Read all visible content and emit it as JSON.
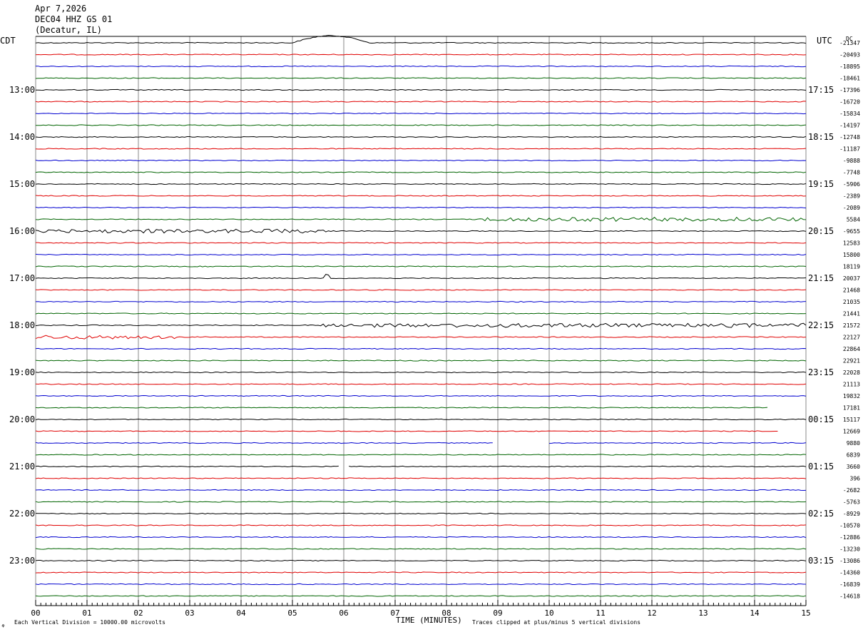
{
  "header": {
    "date": "Apr 7,2026",
    "station": "DEC04 HHZ GS 01",
    "location": "(Decatur, IL)"
  },
  "left_tz": "CDT",
  "right_tz": "UTC",
  "dc_label": "DC",
  "footer": {
    "scale_note": "Each Vertical Division = 10000.00 microvolts",
    "x_label": "TIME (MINUTES)",
    "clip_note": "Traces clipped at plus/minus 5 vertical divisions"
  },
  "colors": {
    "cycle": [
      "#000000",
      "#e00000",
      "#0000d0",
      "#006400"
    ],
    "grid": "#888888"
  },
  "chart_data": {
    "type": "line",
    "title": "DEC04 HHZ GS 01",
    "xlabel": "TIME (MINUTES)",
    "ylabel": "",
    "xlim": [
      0,
      15
    ],
    "x_ticks": [
      "00",
      "01",
      "02",
      "03",
      "04",
      "05",
      "06",
      "07",
      "08",
      "09",
      "10",
      "11",
      "12",
      "13",
      "14",
      "15"
    ],
    "left_hour_labels": [
      "13:00",
      "14:00",
      "15:00",
      "16:00",
      "17:00",
      "18:00",
      "19:00",
      "20:00",
      "21:00",
      "22:00",
      "23:00"
    ],
    "right_hour_labels": [
      "17:15",
      "18:15",
      "19:15",
      "20:15",
      "21:15",
      "22:15",
      "23:15",
      "00:15",
      "01:15",
      "02:15",
      "03:15"
    ],
    "dc_offsets": [
      "-21347",
      "-20493",
      "-18895",
      "-18461",
      "-17396",
      "-16720",
      "-15834",
      "-14197",
      "-12748",
      "-11187",
      "-9888",
      "-7748",
      "-5906",
      "-2389",
      "-2089",
      "5584",
      "-9655",
      "12583",
      "15800",
      "18119",
      "20037",
      "21468",
      "21035",
      "21441",
      "21572",
      "22127",
      "22864",
      "22921",
      "22028",
      "21113",
      "19832",
      "17181",
      "15117",
      "12669",
      "9880",
      "6839",
      "3660",
      "396",
      "-2682",
      "-5763",
      "-8929",
      "-10570",
      "-12886",
      "-13230",
      "-13086",
      "-14360",
      "-16839",
      "-14618"
    ],
    "scale_microvolts_per_division": 10000.0,
    "clip_divisions": 5,
    "trace_count": 48,
    "minutes_per_trace": 15,
    "events": [
      {
        "trace": 0,
        "start_min": 5.0,
        "end_min": 6.5,
        "kind": "long-period swell"
      },
      {
        "trace": 15,
        "start_min": 8.6,
        "end_min": 15.0,
        "kind": "noise burst"
      },
      {
        "trace": 16,
        "start_min": 0.0,
        "end_min": 5.7,
        "kind": "noise burst"
      },
      {
        "trace": 20,
        "start_min": 5.6,
        "end_min": 5.7,
        "kind": "spike"
      },
      {
        "trace": 24,
        "start_min": 5.5,
        "end_min": 15.0,
        "kind": "spike then elevated noise"
      },
      {
        "trace": 25,
        "start_min": 0.0,
        "end_min": 2.7,
        "kind": "elevated noise"
      }
    ],
    "gaps": [
      {
        "trace": 31,
        "start_min": 14.3,
        "end_min": 15.0
      },
      {
        "trace": 33,
        "start_min": 14.5,
        "end_min": 15.0
      },
      {
        "trace": 34,
        "start_min": 8.9,
        "end_min": 10.0
      },
      {
        "trace": 36,
        "start_min": 5.9,
        "end_min": 6.05
      }
    ],
    "grid": true
  }
}
